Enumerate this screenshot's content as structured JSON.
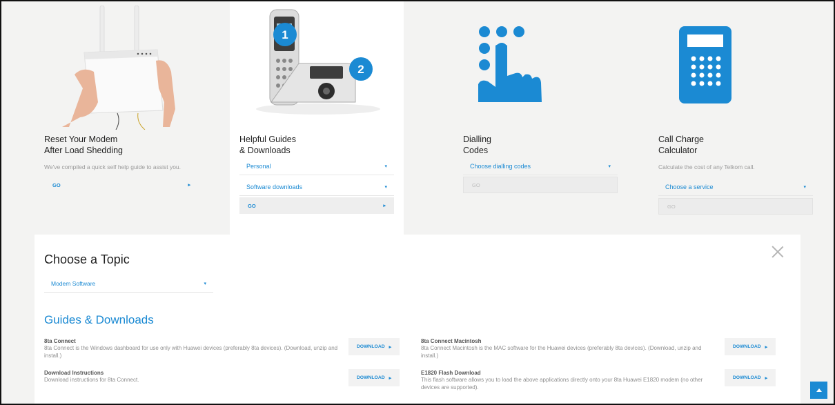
{
  "cards": [
    {
      "title": "Reset Your Modem\nAfter Load Shedding",
      "description": "We've compiled a quick self help guide to assist you.",
      "go_label": "GO"
    },
    {
      "title": "Helpful Guides\n& Downloads",
      "select1": "Personal",
      "select2": "Software downloads",
      "go_label": "GO",
      "badge1": "1",
      "badge2": "2"
    },
    {
      "title": "Dialling\nCodes",
      "select1": "Choose dialling codes",
      "go_label": "GO"
    },
    {
      "title": "Call Charge\nCalculator",
      "description": "Calculate the cost of any Telkom call.",
      "select1": "Choose a service",
      "go_label": "GO"
    }
  ],
  "panel": {
    "heading": "Choose a Topic",
    "topic_value": "Modem Software",
    "section_title": "Guides & Downloads",
    "download_label": "DOWNLOAD",
    "items": [
      {
        "title": "8ta Connect",
        "desc": "8ta Connect is the Windows dashboard for use only with Huawei devices (preferably 8ta devices). (Download, unzip and install.)"
      },
      {
        "title": "8ta Connect Macintosh",
        "desc": "8ta Connect Macintosh is the MAC software for the Huawei devices (preferably 8ta devices). (Download, unzip and install.)"
      },
      {
        "title": "Download Instructions",
        "desc": "Download instructions for 8ta Connect."
      },
      {
        "title": "E1820 Flash Download",
        "desc": "This flash software allows you to load the above applications directly onto your 8ta Huawei E1820 modem (no other devices are supported)."
      }
    ]
  },
  "colors": {
    "accent": "#1b8ad3",
    "background": "#f3f3f2"
  },
  "icons": [
    "modem-image",
    "phone-image",
    "dialpad-hand-icon",
    "calculator-icon",
    "close-icon",
    "scroll-to-top-icon"
  ]
}
